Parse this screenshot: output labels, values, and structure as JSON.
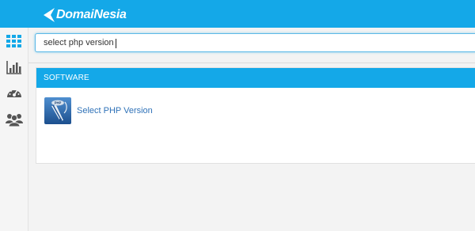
{
  "brand": {
    "name": "DomaiNesia"
  },
  "colors": {
    "primary": "#14a8e8",
    "icon_gray": "#555555",
    "link": "#2f72b8"
  },
  "sidebar": {
    "items": [
      {
        "icon": "grid-icon",
        "active": true
      },
      {
        "icon": "bar-chart-icon",
        "active": false
      },
      {
        "icon": "dashboard-gauge-icon",
        "active": false
      },
      {
        "icon": "users-icon",
        "active": false
      }
    ]
  },
  "search": {
    "value": "select php version",
    "placeholder": ""
  },
  "results": {
    "section_title": "SOFTWARE",
    "items": [
      {
        "label": "Select PHP Version",
        "icon": "php-selector-icon",
        "icon_text": "PHP"
      }
    ]
  }
}
